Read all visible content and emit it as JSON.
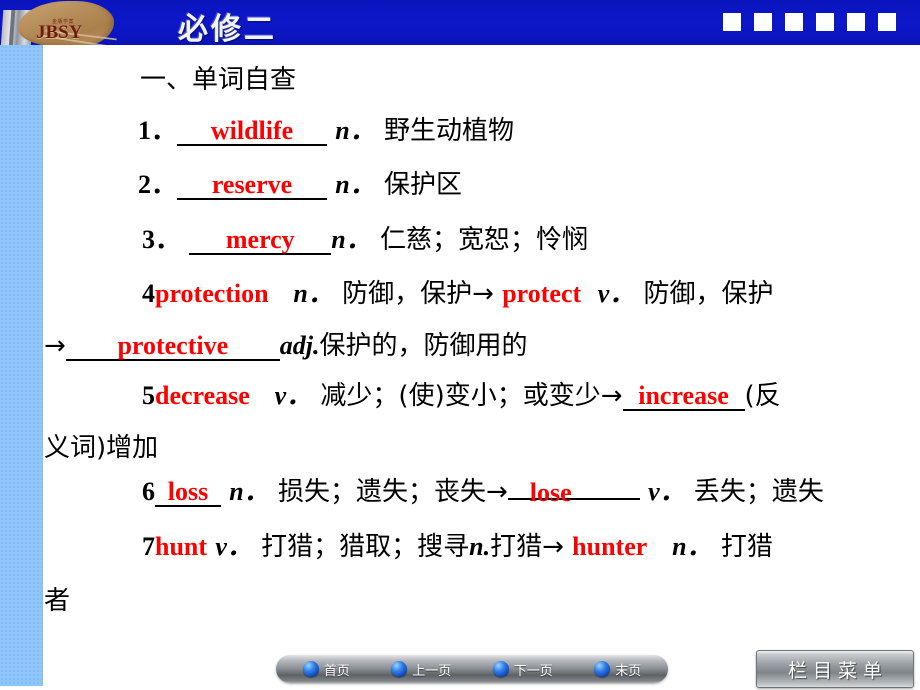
{
  "header": {
    "title": "必修二",
    "logo_text": "JBSY",
    "logo_mini_text": "金版学案",
    "squares_count": 6,
    "background_color": "#0c16c0"
  },
  "content": {
    "section_heading": "一、单词自查",
    "entries": [
      {
        "number": "1．",
        "word": "wildlife",
        "pos": "n．",
        "meaning": "野生动植物"
      },
      {
        "number": "2．",
        "word": "reserve",
        "pos": "n．",
        "meaning": "保护区"
      },
      {
        "number": "3．",
        "word": "mercy",
        "pos": "n．",
        "meaning": "仁慈；宽恕；怜悯"
      },
      {
        "number": "4",
        "word": "protection",
        "pos": "n．",
        "meaning": "防御，保护→",
        "derived_word": "protect",
        "derived_pos": "v．",
        "derived_meaning": "防御，保护",
        "derived_word2": "protective",
        "derived_pos2": "adj.",
        "derived_meaning2": "保护的，防御用的",
        "arrow": "→"
      },
      {
        "number": "5",
        "word": "decrease",
        "pos": "v．",
        "meaning": "减少；(使)变小；或变少→",
        "derived_word": "increase",
        "derived_meaning": "(反义词)增加"
      },
      {
        "number": "6",
        "word": "loss",
        "pos": "n．",
        "meaning": "损失；遗失；丧失→",
        "derived_word": "lose",
        "derived_pos": "v．",
        "derived_meaning": "丢失；遗失"
      },
      {
        "number": "7",
        "word": "hunt",
        "pos": "v．",
        "meaning": "打猎；猎取；搜寻",
        "meaning_pos2": "n.",
        "meaning2": "打猎→",
        "derived_word": "hunter",
        "derived_pos": "n．",
        "derived_meaning": "打猎者"
      }
    ]
  },
  "footer": {
    "nav_items": [
      {
        "label": "首页"
      },
      {
        "label": "上一页"
      },
      {
        "label": "下一页"
      },
      {
        "label": "末页"
      }
    ],
    "menu_button_label": "栏目菜单"
  },
  "colors": {
    "header_blue": "#0c16c0",
    "accent_red": "#ff0000",
    "sidebar_blue": "#8ec5fb"
  }
}
